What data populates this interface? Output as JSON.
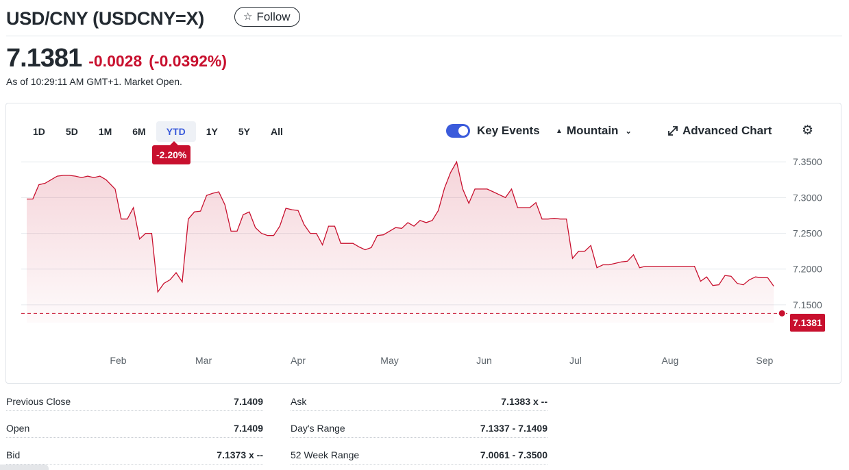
{
  "header": {
    "title": "USD/CNY (USDCNY=X)",
    "follow_label": "Follow",
    "follow_icon": "star-outline-icon"
  },
  "quote": {
    "price": "7.1381",
    "change": "-0.0028",
    "change_pct": "(-0.0392%)",
    "as_of": "As of 10:29:11 AM GMT+1. Market Open.",
    "negative_color": "#c8102e"
  },
  "chart_controls": {
    "ranges": [
      "1D",
      "5D",
      "1M",
      "6M",
      "YTD",
      "1Y",
      "5Y",
      "All"
    ],
    "active_range": "YTD",
    "range_change": "-2.20%",
    "key_events_label": "Key Events",
    "key_events_on": true,
    "chart_type_label": "Mountain",
    "advanced_chart_label": "Advanced Chart",
    "accent_color": "#3b5bdb"
  },
  "chart_data": {
    "type": "area",
    "y_ticks": [
      "7.3500",
      "7.3000",
      "7.2500",
      "7.2000",
      "7.1500"
    ],
    "ylim": [
      7.125,
      7.355
    ],
    "x_ticks": [
      "Feb",
      "Mar",
      "Apr",
      "May",
      "Jun",
      "Jul",
      "Aug",
      "Sep"
    ],
    "x_tick_positions": [
      31,
      59,
      90,
      120,
      151,
      181,
      212,
      243
    ],
    "xlim": [
      1,
      250
    ],
    "current_value": 7.1381,
    "current_label": "7.1381",
    "line_color": "#c8102e",
    "series": [
      {
        "points": [
          [
            1,
            7.298
          ],
          [
            3,
            7.298
          ],
          [
            5,
            7.318
          ],
          [
            7,
            7.32
          ],
          [
            9,
            7.325
          ],
          [
            11,
            7.33
          ],
          [
            13,
            7.331
          ],
          [
            15,
            7.331
          ],
          [
            17,
            7.33
          ],
          [
            19,
            7.328
          ],
          [
            21,
            7.33
          ],
          [
            23,
            7.328
          ],
          [
            25,
            7.33
          ],
          [
            27,
            7.325
          ],
          [
            30,
            7.312
          ],
          [
            32,
            7.27
          ],
          [
            34,
            7.27
          ],
          [
            36,
            7.286
          ],
          [
            38,
            7.242
          ],
          [
            40,
            7.25
          ],
          [
            42,
            7.25
          ],
          [
            44,
            7.168
          ],
          [
            46,
            7.18
          ],
          [
            48,
            7.185
          ],
          [
            50,
            7.195
          ],
          [
            52,
            7.182
          ],
          [
            54,
            7.27
          ],
          [
            56,
            7.28
          ],
          [
            58,
            7.281
          ],
          [
            60,
            7.303
          ],
          [
            62,
            7.306
          ],
          [
            64,
            7.308
          ],
          [
            66,
            7.29
          ],
          [
            68,
            7.253
          ],
          [
            70,
            7.253
          ],
          [
            72,
            7.276
          ],
          [
            74,
            7.28
          ],
          [
            76,
            7.258
          ],
          [
            78,
            7.25
          ],
          [
            80,
            7.247
          ],
          [
            82,
            7.247
          ],
          [
            84,
            7.26
          ],
          [
            86,
            7.285
          ],
          [
            88,
            7.283
          ],
          [
            90,
            7.282
          ],
          [
            92,
            7.262
          ],
          [
            94,
            7.25
          ],
          [
            96,
            7.25
          ],
          [
            98,
            7.234
          ],
          [
            100,
            7.26
          ],
          [
            102,
            7.26
          ],
          [
            104,
            7.236
          ],
          [
            106,
            7.236
          ],
          [
            108,
            7.236
          ],
          [
            110,
            7.231
          ],
          [
            112,
            7.227
          ],
          [
            114,
            7.23
          ],
          [
            116,
            7.247
          ],
          [
            118,
            7.248
          ],
          [
            120,
            7.253
          ],
          [
            122,
            7.258
          ],
          [
            124,
            7.257
          ],
          [
            126,
            7.265
          ],
          [
            128,
            7.26
          ],
          [
            130,
            7.268
          ],
          [
            132,
            7.265
          ],
          [
            134,
            7.268
          ],
          [
            136,
            7.282
          ],
          [
            138,
            7.313
          ],
          [
            140,
            7.335
          ],
          [
            142,
            7.35
          ],
          [
            144,
            7.312
          ],
          [
            146,
            7.292
          ],
          [
            148,
            7.312
          ],
          [
            150,
            7.312
          ],
          [
            152,
            7.312
          ],
          [
            154,
            7.308
          ],
          [
            156,
            7.304
          ],
          [
            158,
            7.3
          ],
          [
            160,
            7.312
          ],
          [
            162,
            7.286
          ],
          [
            164,
            7.286
          ],
          [
            166,
            7.286
          ],
          [
            168,
            7.293
          ],
          [
            170,
            7.27
          ],
          [
            172,
            7.27
          ],
          [
            174,
            7.271
          ],
          [
            176,
            7.27
          ],
          [
            178,
            7.27
          ],
          [
            180,
            7.215
          ],
          [
            182,
            7.225
          ],
          [
            184,
            7.225
          ],
          [
            186,
            7.233
          ],
          [
            188,
            7.202
          ],
          [
            190,
            7.206
          ],
          [
            192,
            7.206
          ],
          [
            194,
            7.208
          ],
          [
            196,
            7.21
          ],
          [
            198,
            7.211
          ],
          [
            200,
            7.22
          ],
          [
            202,
            7.202
          ],
          [
            204,
            7.204
          ],
          [
            206,
            7.204
          ],
          [
            208,
            7.204
          ],
          [
            210,
            7.204
          ],
          [
            212,
            7.204
          ],
          [
            214,
            7.204
          ],
          [
            216,
            7.204
          ],
          [
            218,
            7.204
          ],
          [
            220,
            7.204
          ],
          [
            222,
            7.183
          ],
          [
            224,
            7.189
          ],
          [
            226,
            7.177
          ],
          [
            228,
            7.178
          ],
          [
            230,
            7.191
          ],
          [
            232,
            7.19
          ],
          [
            234,
            7.18
          ],
          [
            236,
            7.178
          ],
          [
            238,
            7.185
          ],
          [
            240,
            7.189
          ],
          [
            242,
            7.188
          ],
          [
            244,
            7.188
          ],
          [
            246,
            7.176
          ]
        ]
      }
    ]
  },
  "stats": {
    "left": [
      {
        "label": "Previous Close",
        "value": "7.1409"
      },
      {
        "label": "Open",
        "value": "7.1409"
      },
      {
        "label": "Bid",
        "value": "7.1373 x --"
      }
    ],
    "right": [
      {
        "label": "Ask",
        "value": "7.1383 x --"
      },
      {
        "label": "Day's Range",
        "value": "7.1337 - 7.1409"
      },
      {
        "label": "52 Week Range",
        "value": "7.0061 - 7.3500"
      }
    ]
  }
}
